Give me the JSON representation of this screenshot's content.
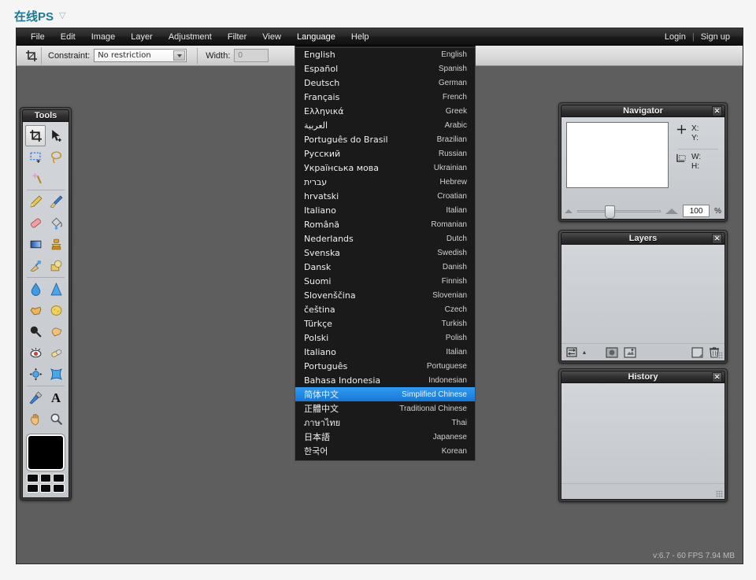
{
  "brand": {
    "name": "在线PS",
    "caret": "▽"
  },
  "menubar": {
    "items": [
      {
        "label": "File",
        "name": "file"
      },
      {
        "label": "Edit",
        "name": "edit"
      },
      {
        "label": "Image",
        "name": "image"
      },
      {
        "label": "Layer",
        "name": "layer"
      },
      {
        "label": "Adjustment",
        "name": "adjustment"
      },
      {
        "label": "Filter",
        "name": "filter"
      },
      {
        "label": "View",
        "name": "view"
      },
      {
        "label": "Language",
        "name": "language"
      },
      {
        "label": "Help",
        "name": "help"
      }
    ],
    "login": "Login",
    "separator": "|",
    "signup": "Sign up"
  },
  "options_bar": {
    "tool_icon": "crop-icon",
    "constraint_label": "Constraint:",
    "constraint_value": "No restriction",
    "width_label": "Width:",
    "width_value": "0"
  },
  "tools": {
    "title": "Tools",
    "items": [
      {
        "name": "crop-tool",
        "glyph": "⬚",
        "selected": true
      },
      {
        "name": "move-tool",
        "glyph": "➤",
        "selected": false
      },
      {
        "name": "rectangular-marquee-tool",
        "glyph": "▭",
        "selected": false
      },
      {
        "name": "lasso-tool",
        "glyph": "◯",
        "selected": false
      },
      {
        "name": "magic-wand-tool",
        "glyph": "✳",
        "selected": false
      },
      {
        "name": "pencil-tool",
        "glyph": "✎",
        "selected": false
      },
      {
        "name": "brush-tool",
        "glyph": "🖌",
        "selected": false
      },
      {
        "name": "eraser-tool",
        "glyph": "▰",
        "selected": false
      },
      {
        "name": "paint-bucket-tool",
        "glyph": "🪣",
        "selected": false
      },
      {
        "name": "gradient-tool",
        "glyph": "▦",
        "selected": false
      },
      {
        "name": "stamp-tool",
        "glyph": "♟",
        "selected": false
      },
      {
        "name": "smudge-tool",
        "glyph": "✒",
        "selected": false
      },
      {
        "name": "shape-tool",
        "glyph": "◻",
        "selected": false
      },
      {
        "name": "blur-tool",
        "glyph": "💧",
        "selected": false
      },
      {
        "name": "sharpen-tool",
        "glyph": "▲",
        "selected": false
      },
      {
        "name": "dodge-tool",
        "glyph": "☜",
        "selected": false
      },
      {
        "name": "sponge-tool",
        "glyph": "⬭",
        "selected": false
      },
      {
        "name": "burn-tool",
        "glyph": "🔍",
        "selected": false
      },
      {
        "name": "hand-paint-tool",
        "glyph": "✋",
        "selected": false
      },
      {
        "name": "red-eye-tool",
        "glyph": "👁",
        "selected": false
      },
      {
        "name": "healing-brush-tool",
        "glyph": "💊",
        "selected": false
      },
      {
        "name": "pinch-tool",
        "glyph": "⊕",
        "selected": false
      },
      {
        "name": "bloat-tool",
        "glyph": "◈",
        "selected": false
      },
      {
        "name": "eyedropper-tool",
        "glyph": "⟋",
        "selected": false
      },
      {
        "name": "type-tool",
        "glyph": "A",
        "selected": false
      },
      {
        "name": "hand-tool",
        "glyph": "🖐",
        "selected": false
      },
      {
        "name": "zoom-tool",
        "glyph": "🔎",
        "selected": false
      }
    ],
    "foreground_color": "#000000",
    "swatch_count": 6
  },
  "navigator": {
    "title": "Navigator",
    "close": "✕",
    "pointer_icon": "crosshair-icon",
    "selection_icon": "selection-icon",
    "x_label": "X:",
    "y_label": "Y:",
    "w_label": "W:",
    "h_label": "H:",
    "zoom_value": "100",
    "zoom_unit": "%"
  },
  "layers": {
    "title": "Layers",
    "close": "✕",
    "footer_buttons": [
      {
        "name": "link-layers-button",
        "glyph": "⇄"
      },
      {
        "name": "layers-menu-arrow",
        "glyph": "▴"
      },
      {
        "name": "layer-mask-button",
        "glyph": "◉"
      },
      {
        "name": "new-group-button",
        "glyph": "▨"
      },
      {
        "name": "new-layer-button",
        "glyph": "◱"
      },
      {
        "name": "delete-layer-button",
        "glyph": "🗑"
      }
    ]
  },
  "history": {
    "title": "History",
    "close": "✕"
  },
  "language_menu": {
    "items": [
      {
        "native": "English",
        "english": "English",
        "selected": false
      },
      {
        "native": "Español",
        "english": "Spanish",
        "selected": false
      },
      {
        "native": "Deutsch",
        "english": "German",
        "selected": false
      },
      {
        "native": "Français",
        "english": "French",
        "selected": false
      },
      {
        "native": "Ελληνικά",
        "english": "Greek",
        "selected": false
      },
      {
        "native": "العربية",
        "english": "Arabic",
        "selected": false
      },
      {
        "native": "Português do Brasil",
        "english": "Brazilian",
        "selected": false
      },
      {
        "native": "Русский",
        "english": "Russian",
        "selected": false
      },
      {
        "native": "Українська мова",
        "english": "Ukrainian",
        "selected": false
      },
      {
        "native": "עברית",
        "english": "Hebrew",
        "selected": false
      },
      {
        "native": "hrvatski",
        "english": "Croatian",
        "selected": false
      },
      {
        "native": "Italiano",
        "english": "Italian",
        "selected": false
      },
      {
        "native": "Română",
        "english": "Romanian",
        "selected": false
      },
      {
        "native": "Nederlands",
        "english": "Dutch",
        "selected": false
      },
      {
        "native": "Svenska",
        "english": "Swedish",
        "selected": false
      },
      {
        "native": "Dansk",
        "english": "Danish",
        "selected": false
      },
      {
        "native": "Suomi",
        "english": "Finnish",
        "selected": false
      },
      {
        "native": "Slovenščina",
        "english": "Slovenian",
        "selected": false
      },
      {
        "native": "čeština",
        "english": "Czech",
        "selected": false
      },
      {
        "native": "Türkçe",
        "english": "Turkish",
        "selected": false
      },
      {
        "native": "Polski",
        "english": "Polish",
        "selected": false
      },
      {
        "native": "Italiano",
        "english": "Italian",
        "selected": false
      },
      {
        "native": "Português",
        "english": "Portuguese",
        "selected": false
      },
      {
        "native": "Bahasa Indonesia",
        "english": "Indonesian",
        "selected": false
      },
      {
        "native": "简体中文",
        "english": "Simplified Chinese",
        "selected": true
      },
      {
        "native": "正體中文",
        "english": "Traditional Chinese",
        "selected": false
      },
      {
        "native": "ภาษาไทย",
        "english": "Thai",
        "selected": false
      },
      {
        "native": "日本語",
        "english": "Japanese",
        "selected": false
      },
      {
        "native": "한국어",
        "english": "Korean",
        "selected": false
      }
    ]
  },
  "statusbar": {
    "text": "v:6.7 - 60 FPS 7.94 MB"
  },
  "colors": {
    "brand": "#1b7a95",
    "workspace": "#5e5e5e",
    "menubar": "#1a1a1a",
    "highlight": "#1678d8"
  }
}
